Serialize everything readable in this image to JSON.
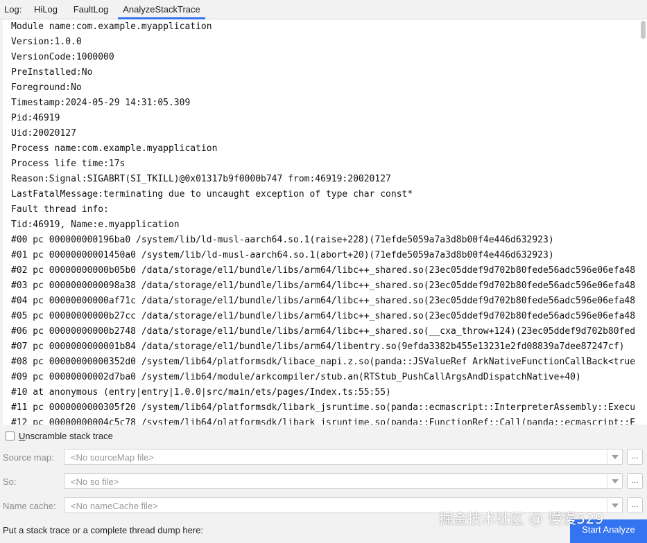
{
  "tabs": {
    "label": "Log:",
    "items": [
      "HiLog",
      "FaultLog",
      "AnalyzeStackTrace"
    ],
    "active": "AnalyzeStackTrace"
  },
  "log_lines": [
    "Module name:com.example.myapplication",
    "Version:1.0.0",
    "VersionCode:1000000",
    "PreInstalled:No",
    "Foreground:No",
    "Timestamp:2024-05-29 14:31:05.309",
    "Pid:46919",
    "Uid:20020127",
    "Process name:com.example.myapplication",
    "Process life time:17s",
    "Reason:Signal:SIGABRT(SI_TKILL)@0x01317b9f0000b747 from:46919:20020127",
    "LastFatalMessage:terminating due to uncaught exception of type char const*",
    "Fault thread info:",
    "Tid:46919, Name:e.myapplication",
    "#00 pc 000000000196ba0 /system/lib/ld-musl-aarch64.so.1(raise+228)(71efde5059a7a3d8b00f4e446d632923)",
    "#01 pc 00000000001450a0 /system/lib/ld-musl-aarch64.so.1(abort+20)(71efde5059a7a3d8b00f4e446d632923)",
    "#02 pc 00000000000b05b0 /data/storage/el1/bundle/libs/arm64/libc++_shared.so(23ec05ddef9d702b80fede56adc596e06efa48",
    "#03 pc 0000000000098a38 /data/storage/el1/bundle/libs/arm64/libc++_shared.so(23ec05ddef9d702b80fede56adc596e06efa48",
    "#04 pc 00000000000af71c /data/storage/el1/bundle/libs/arm64/libc++_shared.so(23ec05ddef9d702b80fede56adc596e06efa48",
    "#05 pc 00000000000b27cc /data/storage/el1/bundle/libs/arm64/libc++_shared.so(23ec05ddef9d702b80fede56adc596e06efa48",
    "#06 pc 00000000000b2748 /data/storage/el1/bundle/libs/arm64/libc++_shared.so(__cxa_throw+124)(23ec05ddef9d702b80fed",
    "#07 pc 0000000000001b84 /data/storage/el1/bundle/libs/arm64/libentry.so(9efda3382b455e13231e2fd08839a7dee87247cf)",
    "#08 pc 00000000000352d0 /system/lib64/platformsdk/libace_napi.z.so(panda::JSValueRef ArkNativeFunctionCallBack<true",
    "#09 pc 00000000002d7ba0 /system/lib64/module/arkcompiler/stub.an(RTStub_PushCallArgsAndDispatchNative+40)",
    "#10 at anonymous (entry|entry|1.0.0|src/main/ets/pages/Index.ts:55:55)",
    "#11 pc 0000000000305f20 /system/lib64/platformsdk/libark_jsruntime.so(panda::ecmascript::InterpreterAssembly::Execu",
    "#12 pc 00000000004c5c78 /system/lib64/platformsdk/libark_jsruntime.so(panda::FunctionRef::Call(panda::ecmascript::E"
  ],
  "unscramble": {
    "label_mnemonic": "U",
    "label_rest": "nscramble stack trace",
    "checked": false
  },
  "source_map": {
    "label": "Source map:",
    "placeholder": "<No sourceMap file>",
    "browse": "..."
  },
  "so": {
    "label": "So:",
    "placeholder": "<No so file>",
    "browse": "..."
  },
  "name_cache": {
    "label": "Name cache:",
    "placeholder": "<No nameCache file>",
    "browse": "..."
  },
  "prompt": "Put a stack trace or a complete thread dump here:",
  "analyze_button": "Start Analyze",
  "watermark": "掘金技术社区 @ 慢慢529",
  "colors": {
    "accent": "#3574f0",
    "panel_bg": "#ffffff",
    "chrome_bg": "#f2f2f2"
  }
}
